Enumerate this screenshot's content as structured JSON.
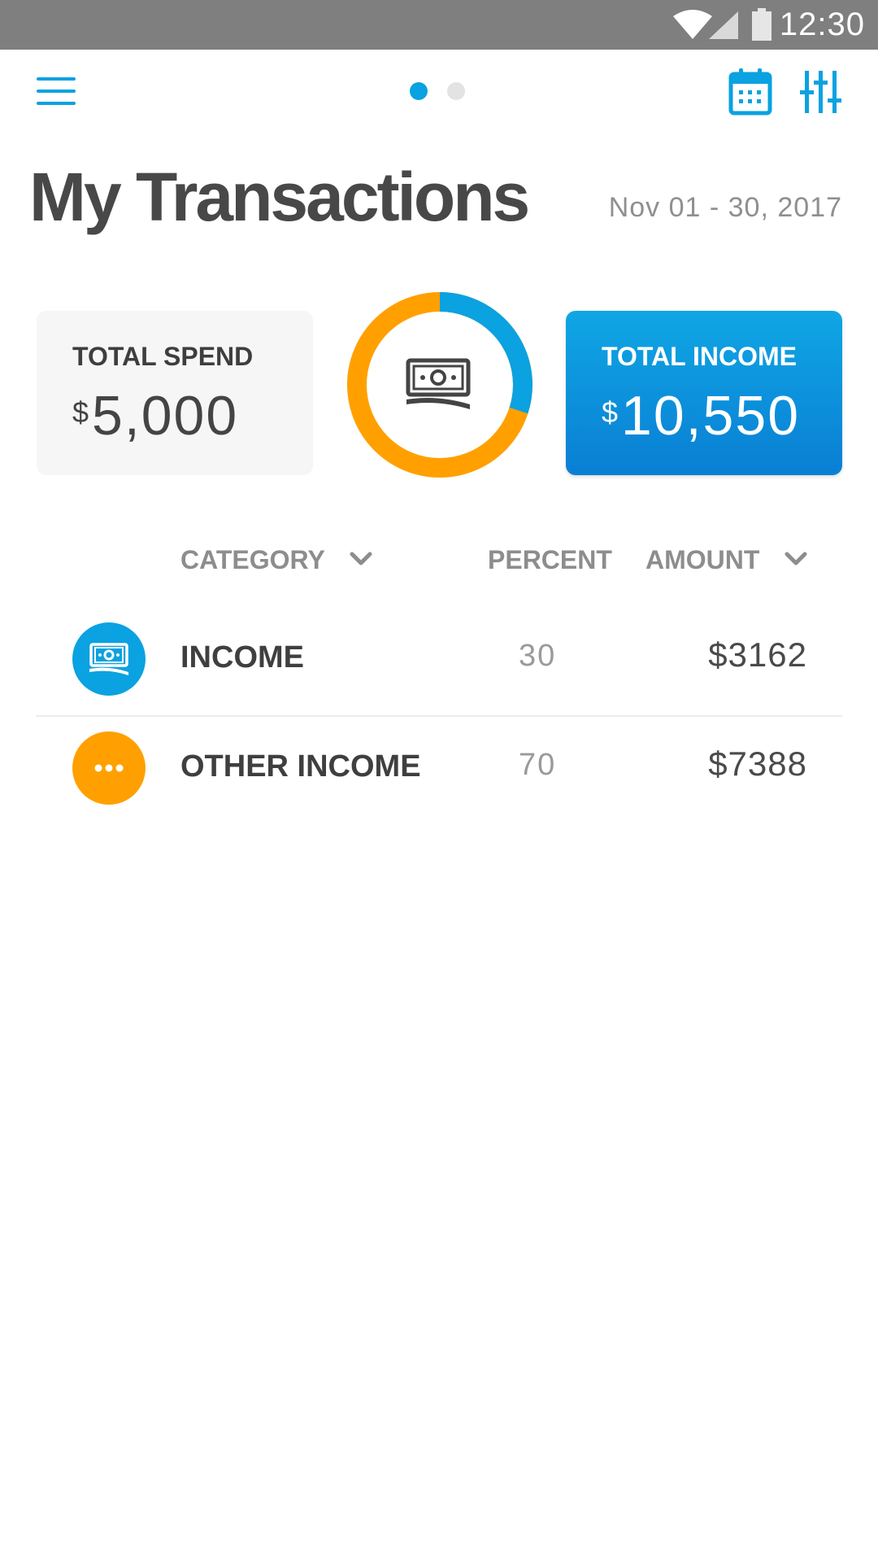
{
  "status_bar": {
    "time": "12:30"
  },
  "header": {
    "page_indicator": {
      "count": 2,
      "active": 1
    }
  },
  "title": "My Transactions",
  "date_range": "Nov 01 - 30, 2017",
  "summary": {
    "spend": {
      "label": "TOTAL SPEND",
      "currency": "$",
      "amount": "5,000"
    },
    "income": {
      "label": "TOTAL INCOME",
      "currency": "$",
      "amount": "10,550"
    }
  },
  "donut": {
    "segments": [
      {
        "fraction": 0.3,
        "color": "#0aa2e0"
      },
      {
        "fraction": 0.7,
        "color": "#ffa000"
      }
    ]
  },
  "table": {
    "headers": {
      "category": "CATEGORY",
      "percent": "PERCENT",
      "amount": "AMOUNT"
    },
    "rows": [
      {
        "category": "INCOME",
        "percent": "30",
        "amount": "$3162",
        "icon": "cash-icon",
        "color": "#0aa2e0"
      },
      {
        "category": "OTHER INCOME",
        "percent": "70",
        "amount": "$7388",
        "icon": "more-dots-icon",
        "color": "#ffa000"
      }
    ]
  },
  "colors": {
    "accent": "#0aa2e0",
    "orange": "#ffa000",
    "text": "#444444",
    "muted": "#8d8d8d"
  }
}
